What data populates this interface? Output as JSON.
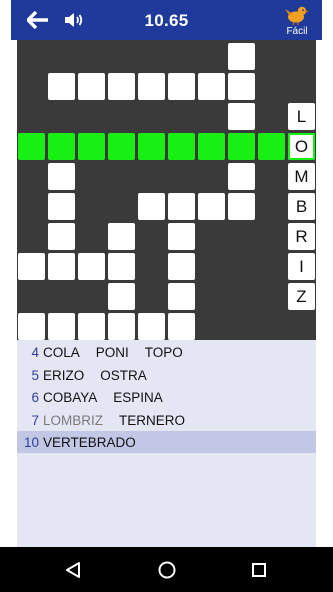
{
  "header": {
    "timer": "10.65",
    "level_label": "Fácil",
    "back_icon": "back-arrow-icon",
    "sound_icon": "volume-icon",
    "level_icon": "bird-icon"
  },
  "colors": {
    "appbar": "#1f3a9a",
    "board_bg": "#3a3a3a",
    "highlight": "#18ef12",
    "list_bg": "#e4e6f4",
    "selected_row": "#c3c7e6",
    "number_color": "#2e3f9a"
  },
  "board": {
    "vertical_word_letters": [
      "L",
      "O",
      "M",
      "B",
      "R",
      "I",
      "Z"
    ]
  },
  "word_list": [
    {
      "number": "4",
      "words": [
        "COLA",
        "PONI",
        "TOPO"
      ],
      "solved": [
        false,
        false,
        false
      ],
      "selected": false
    },
    {
      "number": "5",
      "words": [
        "ERIZO",
        "OSTRA"
      ],
      "solved": [
        false,
        false
      ],
      "selected": false
    },
    {
      "number": "6",
      "words": [
        "COBAYA",
        "ESPINA"
      ],
      "solved": [
        false,
        false
      ],
      "selected": false
    },
    {
      "number": "7",
      "words": [
        "LOMBRIZ",
        "TERNERO"
      ],
      "solved": [
        true,
        false
      ],
      "selected": false
    },
    {
      "number": "10",
      "words": [
        "VERTEBRADO"
      ],
      "solved": [
        false
      ],
      "selected": true
    }
  ],
  "navbar": {
    "back_icon": "nav-back-icon",
    "home_icon": "nav-home-icon",
    "recents_icon": "nav-recents-icon"
  }
}
